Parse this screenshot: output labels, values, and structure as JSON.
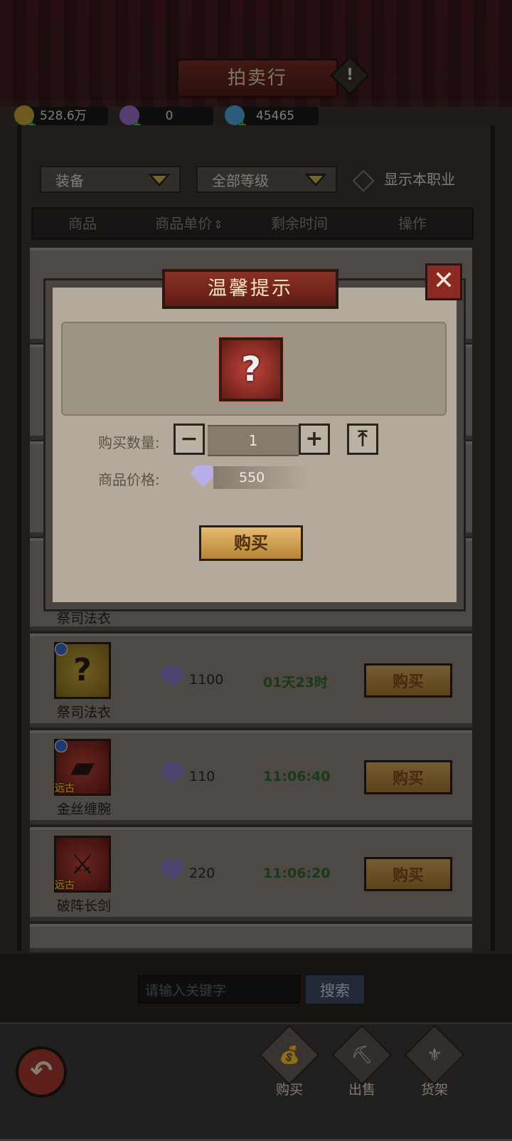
{
  "header": {
    "title": "拍卖行",
    "warning_icon": "!"
  },
  "currencies": [
    {
      "name": "gold",
      "value": "528.6万",
      "color": "#c9a23d"
    },
    {
      "name": "purple-gem",
      "value": "0",
      "color": "#9b6fd0"
    },
    {
      "name": "blue-gem",
      "value": "45465",
      "color": "#4fa9e0"
    }
  ],
  "filters": {
    "category": "装备",
    "level": "全部等级",
    "show_own_class": "显示本职业"
  },
  "table_headers": [
    "商品",
    "商品单价",
    "剩余时间",
    "操作"
  ],
  "sort_icon": "⇕",
  "rows": [
    {
      "name": "祭司法衣",
      "price": "1100",
      "time": "01天23时",
      "button": "购买",
      "rarity": "",
      "frame": "gold",
      "glyph": "?"
    },
    {
      "name": "金丝缠腕",
      "price": "110",
      "time": "11:06:40",
      "button": "购买",
      "rarity": "远古",
      "frame": "red",
      "glyph": "▰"
    },
    {
      "name": "破阵长剑",
      "price": "220",
      "time": "11:06:20",
      "button": "购买",
      "rarity": "远古",
      "frame": "red",
      "glyph": "⚔"
    }
  ],
  "hidden_row_name": "祭司法衣",
  "dialog": {
    "title": "温馨提示",
    "close": "✕",
    "item_glyph": "?",
    "qty_label": "购买数量:",
    "qty_value": "1",
    "minus": "−",
    "plus": "+",
    "max": "⤒",
    "price_label": "商品价格:",
    "price_value": "550",
    "buy": "购买"
  },
  "search": {
    "placeholder": "请输入关键字",
    "button": "搜索"
  },
  "bottom_tabs": [
    {
      "label": "购买",
      "icon": "💰"
    },
    {
      "label": "出售",
      "icon": "⛏"
    },
    {
      "label": "货架",
      "icon": "⚜"
    }
  ],
  "back_icon": "↶"
}
